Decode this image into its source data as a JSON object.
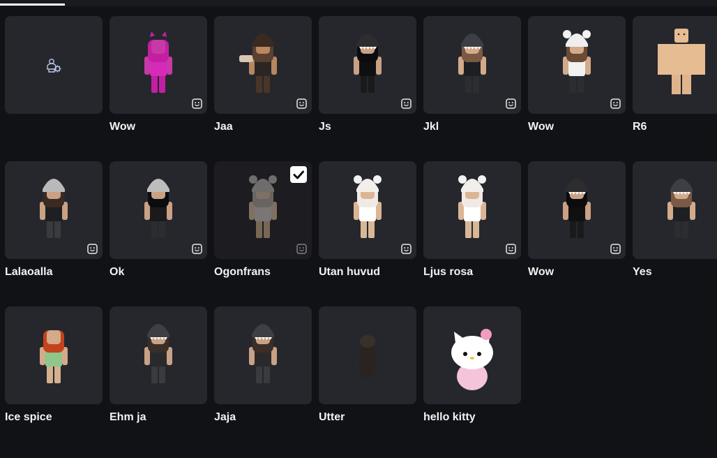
{
  "tabs": {
    "active_indicator": "selected-tab"
  },
  "create_tile": {
    "icon": "create-outfit-icon"
  },
  "outfits": [
    {
      "name": "Wow",
      "style": "pink",
      "emote": true
    },
    {
      "name": "Jaa",
      "style": "brown-bear",
      "emote": true
    },
    {
      "name": "Js",
      "style": "black-shark",
      "emote": true
    },
    {
      "name": "Jkl",
      "style": "shark-hood-brown",
      "emote": true
    },
    {
      "name": "Wow",
      "style": "white-bear-hood",
      "emote": true
    },
    {
      "name": "R6",
      "style": "blocky",
      "emote": false
    },
    {
      "name": "Lalaoalla",
      "style": "fur-hat-dark",
      "emote": true
    },
    {
      "name": "Ok",
      "style": "fur-hat-black",
      "emote": true
    },
    {
      "name": "Ogonfrans",
      "style": "grey-bear",
      "emote": true,
      "selected": true
    },
    {
      "name": "Utan huvud",
      "style": "white-bear-top",
      "emote": true
    },
    {
      "name": "Ljus rosa",
      "style": "white-bear-top",
      "emote": true
    },
    {
      "name": "Wow",
      "style": "black-shark",
      "emote": true
    },
    {
      "name": "Yes",
      "style": "shark-hood-brown",
      "emote": false
    },
    {
      "name": "Ice spice",
      "style": "ginger",
      "emote": false
    },
    {
      "name": "Ehm ja",
      "style": "shark-hood-dark",
      "emote": false
    },
    {
      "name": "Jaja",
      "style": "shark-hood-dark",
      "emote": false
    },
    {
      "name": "Utter",
      "style": "otter",
      "emote": false
    },
    {
      "name": "hello kitty",
      "style": "kitty",
      "emote": false
    }
  ],
  "colors": {
    "background": "#111216",
    "tile": "#26272d",
    "text": "#f2f2f2"
  }
}
